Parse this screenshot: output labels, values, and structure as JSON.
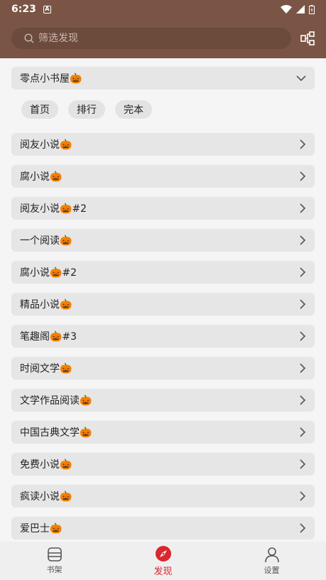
{
  "status_bar": {
    "time": "6:23",
    "left_icon": "A"
  },
  "search": {
    "placeholder": "筛选发现"
  },
  "group": {
    "title": "零点小书屋🎃"
  },
  "chips": [
    "首页",
    "排行",
    "完本"
  ],
  "items": [
    "阅友小说🎃",
    "腐小说🎃",
    "阅友小说🎃#2",
    "一个阅读🎃",
    "腐小说🎃#2",
    "精品小说🎃",
    "笔趣阁🎃#3",
    "时阅文学🎃",
    "文学作品阅读🎃",
    "中国古典文学🎃",
    "免费小说🎃",
    "疯读小说🎃",
    "爱巴士🎃"
  ],
  "nav": {
    "bookshelf": "书架",
    "discover": "发现",
    "settings": "设置"
  },
  "colors": {
    "primary": "#7a5546",
    "accent": "#d9282f"
  }
}
